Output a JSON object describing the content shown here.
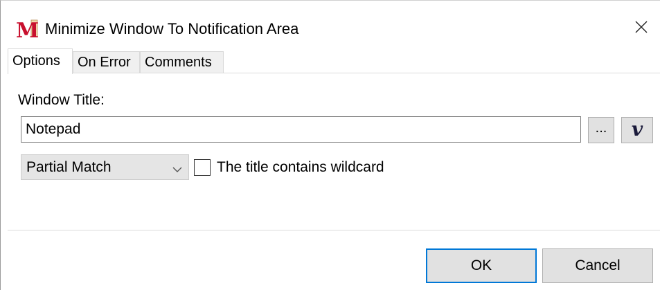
{
  "window": {
    "title": "Minimize Window To Notification Area",
    "app_icon": "macro-m-icon",
    "close_icon": "close-icon"
  },
  "tabs": [
    {
      "label": "Options",
      "active": true
    },
    {
      "label": "On Error",
      "active": false
    },
    {
      "label": "Comments",
      "active": false
    }
  ],
  "options": {
    "window_title_label": "Window Title:",
    "window_title_value": "Notepad",
    "browse_label": "...",
    "variable_label": "v",
    "match_mode": {
      "selected": "Partial Match",
      "icon": "chevron-down-icon"
    },
    "wildcard": {
      "label": "The title contains wildcard",
      "checked": false
    }
  },
  "footer": {
    "ok_label": "OK",
    "cancel_label": "Cancel"
  },
  "colors": {
    "accent": "#0078d7",
    "icon_red": "#c8102e",
    "button_face": "#e1e1e1"
  }
}
